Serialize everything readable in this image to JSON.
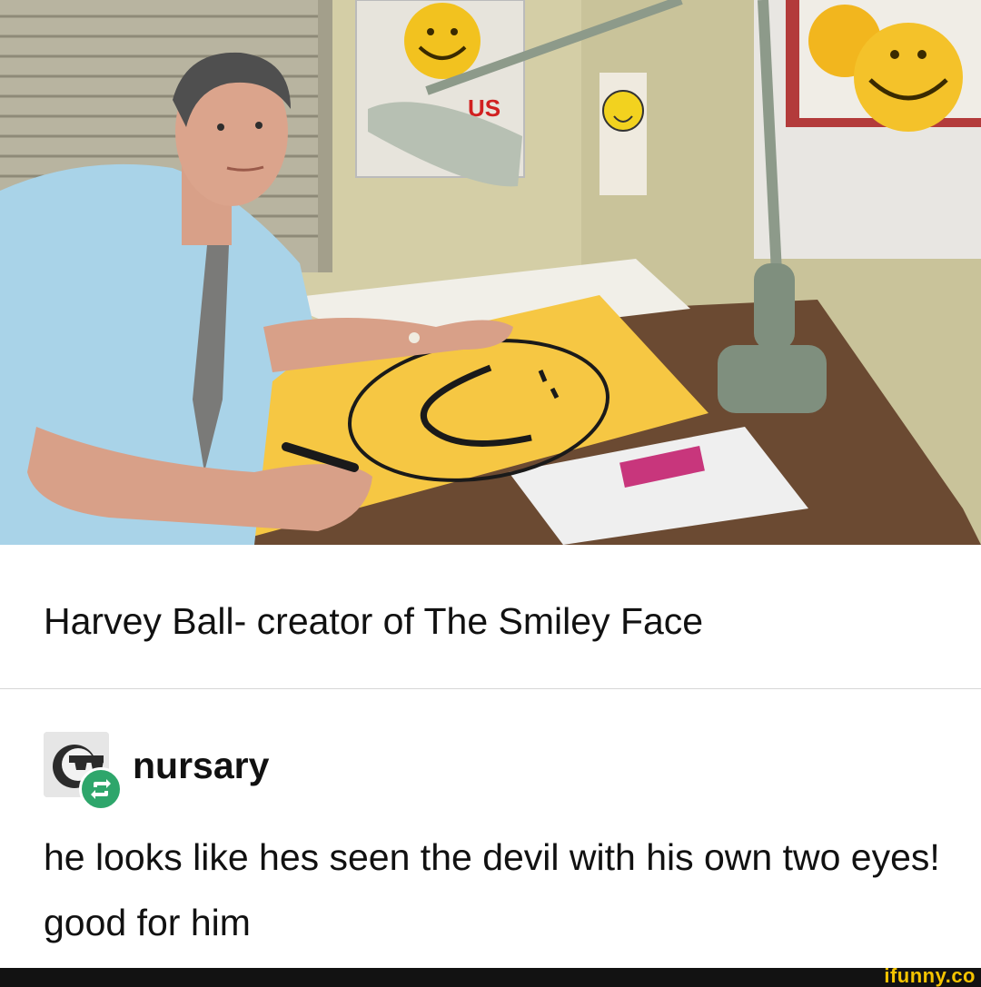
{
  "post": {
    "photo": {
      "icon": "smiley-face-photo",
      "poster_text": "US"
    },
    "caption": "Harvey Ball- creator of The Smiley Face"
  },
  "reblog": {
    "username": "nursary",
    "avatar_icon": "sunglasses-avatar-icon",
    "badge_icon": "reblog-icon",
    "badge_color": "#2ea66b",
    "comment": "he looks like hes seen the devil with his own two eyes! good for him"
  },
  "footer": {
    "watermark": "ifunny.co",
    "watermark_color": "#f5c400"
  }
}
